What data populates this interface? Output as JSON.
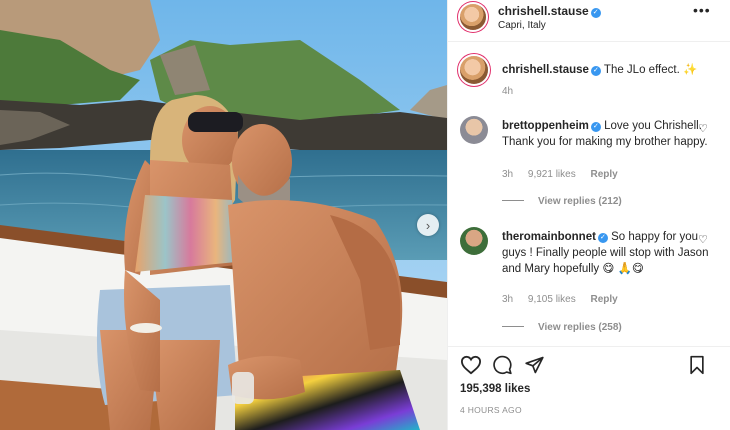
{
  "post": {
    "author": "chrishell.stause",
    "location": "Capri, Italy",
    "more_icon": "more-options-icon"
  },
  "caption": {
    "username": "chrishell.stause",
    "text": " The JLo effect. ✨",
    "time": "4h"
  },
  "comments": [
    {
      "username": "brettoppenheim",
      "text": " Love you Chrishell. Thank you for making my brother happy.",
      "time": "3h",
      "likes": "9,921 likes",
      "reply": "Reply",
      "replies": "View replies (212)"
    },
    {
      "username": "theromainbonnet",
      "text": " So happy for you guys ! Finally people will stop with Jason and Mary hopefully 😋 🙏😋",
      "time": "3h",
      "likes": "9,105 likes",
      "reply": "Reply",
      "replies": "View replies (258)"
    }
  ],
  "actions": {
    "like_icon": "heart-icon",
    "comment_icon": "comment-icon",
    "share_icon": "share-icon",
    "save_icon": "bookmark-icon"
  },
  "likes": "195,398 likes",
  "posted": "4 HOURS AGO",
  "colors": {
    "verified": "#3897f0",
    "story_ring": "#e1306c",
    "secondary_text": "#8e8e8e"
  }
}
